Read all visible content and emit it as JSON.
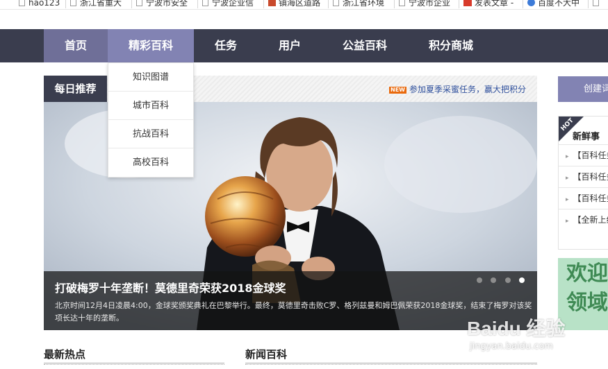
{
  "bookmarks": [
    {
      "label": "hao123",
      "icon": "page-icon"
    },
    {
      "label": "浙江省重大",
      "icon": "page-icon"
    },
    {
      "label": "宁波市安全",
      "icon": "page-icon"
    },
    {
      "label": "宁波企业信",
      "icon": "page-icon"
    },
    {
      "label": "镇海区道路",
      "icon": "badge-icon"
    },
    {
      "label": "浙江省环境",
      "icon": "page-icon"
    },
    {
      "label": "宁波市企业",
      "icon": "page-icon"
    },
    {
      "label": "发表文章 -",
      "icon": "weibo-icon"
    },
    {
      "label": "百度不大中",
      "icon": "paw-icon"
    }
  ],
  "nav": {
    "items": [
      "首页",
      "精彩百科",
      "任务",
      "用户",
      "公益百科",
      "积分商城"
    ],
    "active_index": 1
  },
  "dropdown": {
    "items": [
      "知识图谱",
      "城市百科",
      "抗战百科",
      "高校百科"
    ]
  },
  "recommend": {
    "title": "每日推荐",
    "promo_badge": "NEW",
    "promo_text": "参加夏季采蜜任务，赢大把积分"
  },
  "slider": {
    "title": "打破梅罗十年垄断！莫德里奇荣获2018金球奖",
    "text": "北京时间12月4日凌晨4:00，金球奖颁奖典礼在巴黎举行。最终，莫德里奇击败C罗、格列兹曼和姆巴佩荣获2018金球奖，结束了梅罗对该奖项长达十年的垄断。",
    "dot_count": 4,
    "active_dot": 3
  },
  "sections": {
    "latest": "最新热点",
    "news": "新闻百科"
  },
  "right": {
    "create_label": "创建词条",
    "hot_tag": "HOT",
    "news_title": "新鲜事",
    "news_items": [
      "【百科任务】",
      "【百科任务】",
      "【百科任务】",
      "【全新上线】"
    ],
    "welcome_text": "欢迎领域"
  },
  "watermark": {
    "logo": "Baidu 经验",
    "url": "jingyan.baidu.com"
  },
  "colors": {
    "nav_bg": "#3a3d4e",
    "nav_active": "#8283b3",
    "promo_badge": "#e9690c",
    "link": "#2e4f9c"
  }
}
